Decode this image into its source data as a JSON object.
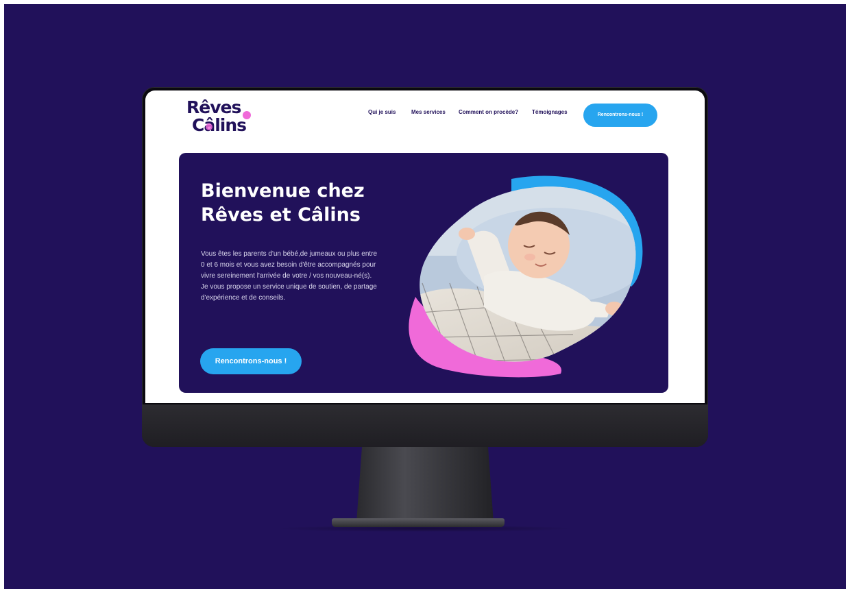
{
  "site": {
    "logo_line1": "Rêves",
    "logo_line2": "Câlins",
    "logo_alt": "Rêves & Câlins"
  },
  "nav": {
    "items": [
      {
        "label": "Qui je suis"
      },
      {
        "label": "Mes services"
      },
      {
        "label": "Comment on procède?"
      },
      {
        "label": "Témoignages"
      }
    ],
    "cta_label": "Rencontrons-nous !"
  },
  "hero": {
    "title": "Bienvenue chez Rêves et Câlins",
    "text": "Vous êtes les parents d'un bébé,de jumeaux ou plus entre 0 et 6 mois et vous avez besoin d'être accompagnés pour vivre sereinement l'arrivée de votre / vos nouveau-né(s). Je vous propose un service unique de soutien, de partage d'expérience et de conseils.",
    "cta_label": "Rencontrons-nous !",
    "image_icon": "sleeping-baby-photo"
  },
  "colors": {
    "backdrop": "#21115a",
    "hero_bg": "#21115a",
    "accent_blue": "#27a5ef",
    "accent_pink": "#f06ad9",
    "screen_bg": "#ffffff"
  }
}
